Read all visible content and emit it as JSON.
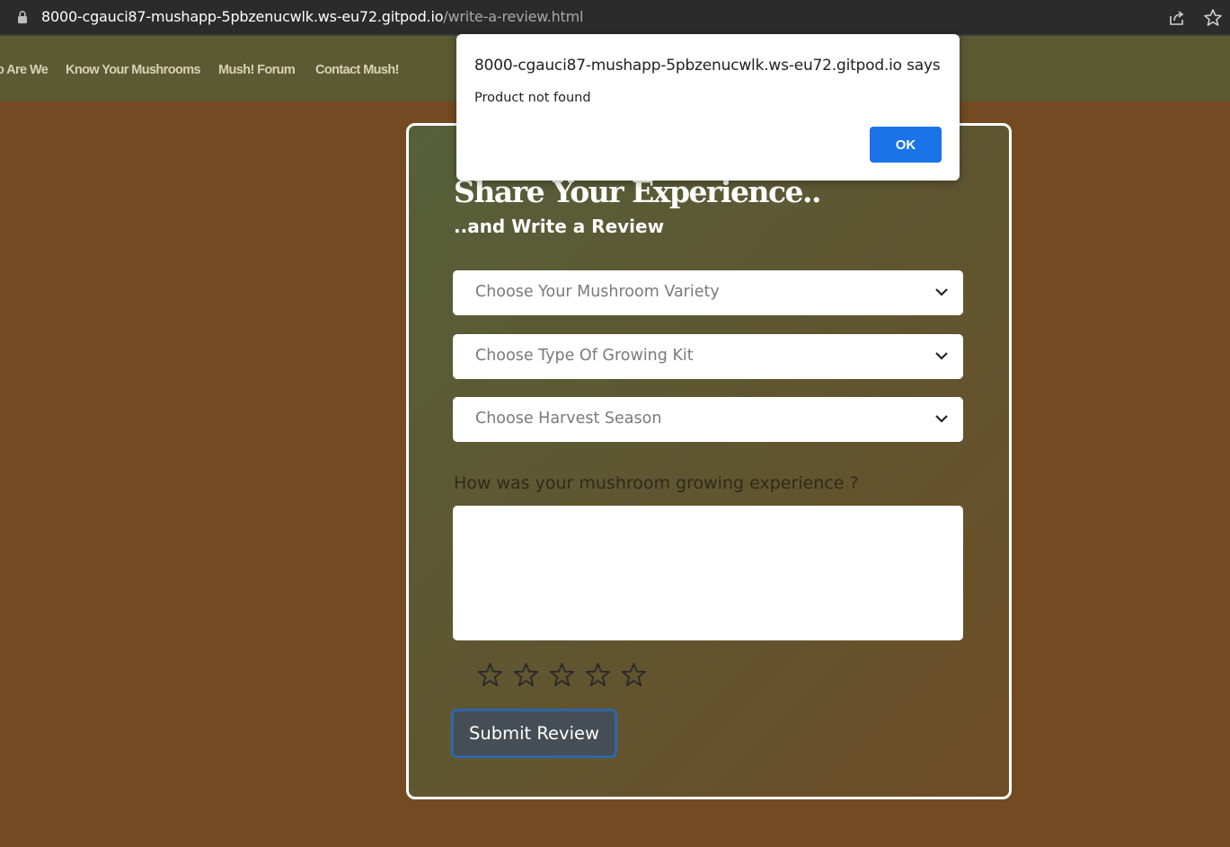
{
  "browser": {
    "url_host": "8000-cgauci87-mushapp-5pbzenucwlk.ws-eu72.gitpod.io",
    "url_path": "/write-a-review.html"
  },
  "nav": {
    "items": [
      {
        "label": "o Are We"
      },
      {
        "label": "Know Your Mushrooms"
      },
      {
        "label": "Mush! Forum"
      },
      {
        "label": "Contact Mush!"
      }
    ]
  },
  "review": {
    "title": "Share Your Experience..",
    "subtitle": "..and Write a Review",
    "selects": [
      {
        "placeholder": "Choose Your Mushroom Variety"
      },
      {
        "placeholder": "Choose Type Of Growing Kit"
      },
      {
        "placeholder": "Choose Harvest Season"
      }
    ],
    "question": "How was your mushroom growing experience ?",
    "textarea_value": "",
    "rating": {
      "selected": 0,
      "max": 5
    },
    "submit_label": "Submit Review"
  },
  "dialog": {
    "title": "8000-cgauci87-mushapp-5pbzenucwlk.ws-eu72.gitpod.io says",
    "message": "Product not found",
    "ok_label": "OK"
  },
  "colors": {
    "page_background": "#744a22",
    "navbar": "#5c5a32",
    "dialog_button": "#1a73e8",
    "submit_border": "#2e67a8"
  }
}
